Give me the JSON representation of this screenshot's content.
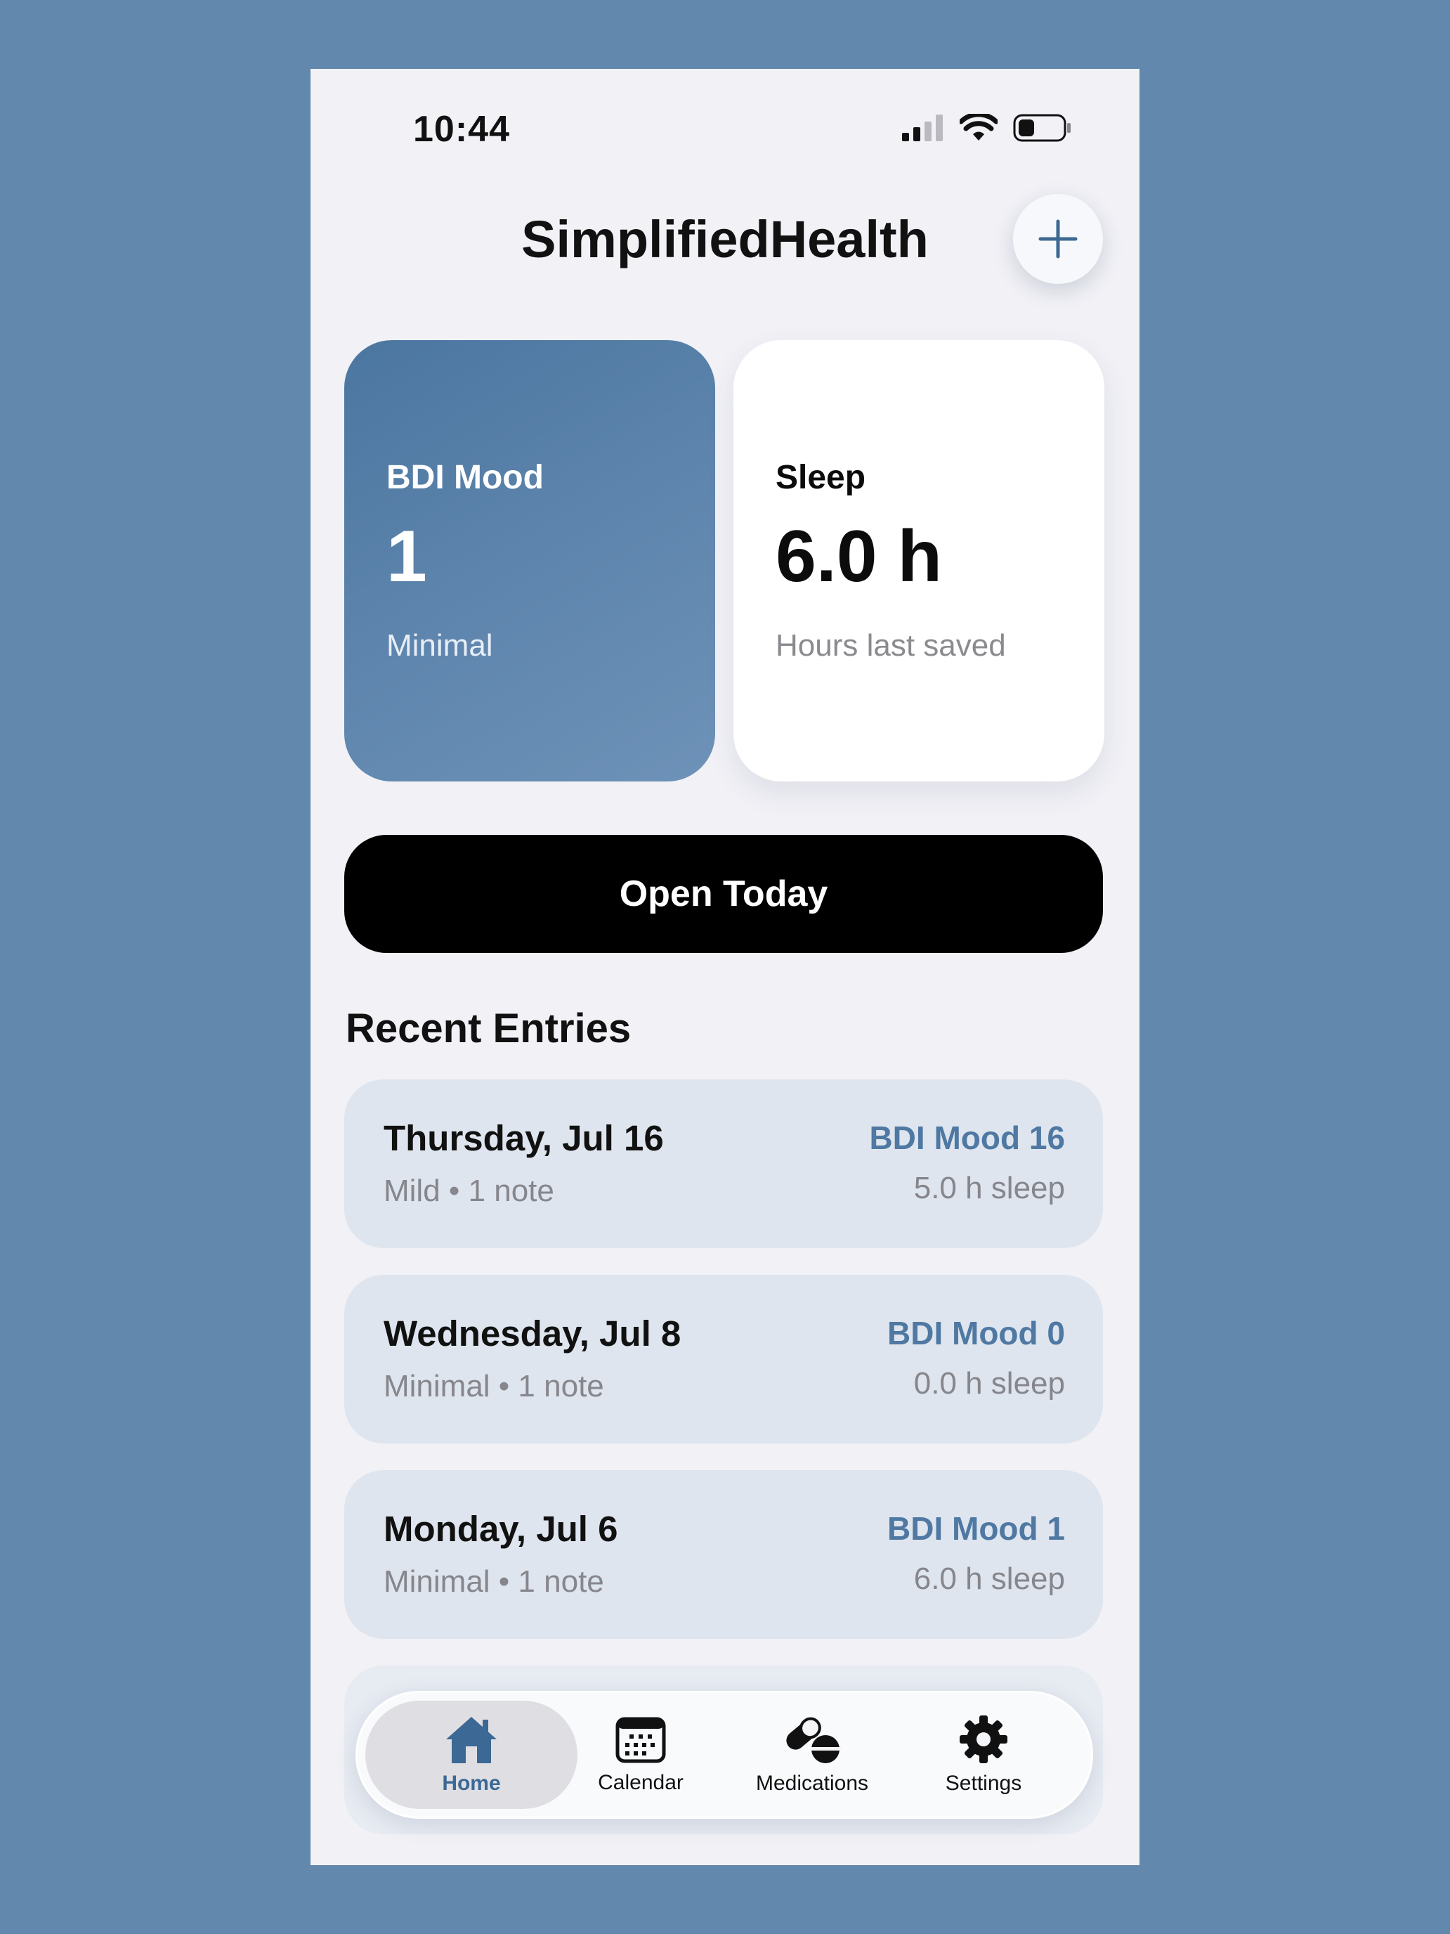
{
  "status_bar": {
    "time": "10:44"
  },
  "header": {
    "title": "SimplifiedHealth",
    "add_icon": "plus-icon"
  },
  "cards": {
    "mood": {
      "label": "BDI Mood",
      "value": "1",
      "caption": "Minimal"
    },
    "sleep": {
      "label": "Sleep",
      "value": "6.0 h",
      "caption": "Hours last saved"
    }
  },
  "primary_action": {
    "label": "Open Today"
  },
  "recent": {
    "title": "Recent Entries",
    "entries": [
      {
        "date": "Thursday, Jul 16",
        "meta": "Mild • 1 note",
        "mood": "BDI Mood 16",
        "sleep": "5.0 h sleep"
      },
      {
        "date": "Wednesday, Jul 8",
        "meta": "Minimal • 1 note",
        "mood": "BDI Mood 0",
        "sleep": "0.0 h sleep"
      },
      {
        "date": "Monday, Jul 6",
        "meta": "Minimal • 1 note",
        "mood": "BDI Mood 1",
        "sleep": "6.0 h sleep"
      }
    ]
  },
  "tab_bar": {
    "tabs": [
      {
        "label": "Home",
        "icon": "house-icon",
        "active": true
      },
      {
        "label": "Calendar",
        "icon": "calendar-icon",
        "active": false
      },
      {
        "label": "Medications",
        "icon": "pills-icon",
        "active": false
      },
      {
        "label": "Settings",
        "icon": "gear-icon",
        "active": false
      }
    ]
  },
  "colors": {
    "background": "#6388ad",
    "accent": "#4f78a2",
    "card_mood": "#5a82ab",
    "entry_bg": "#dee5ee"
  }
}
